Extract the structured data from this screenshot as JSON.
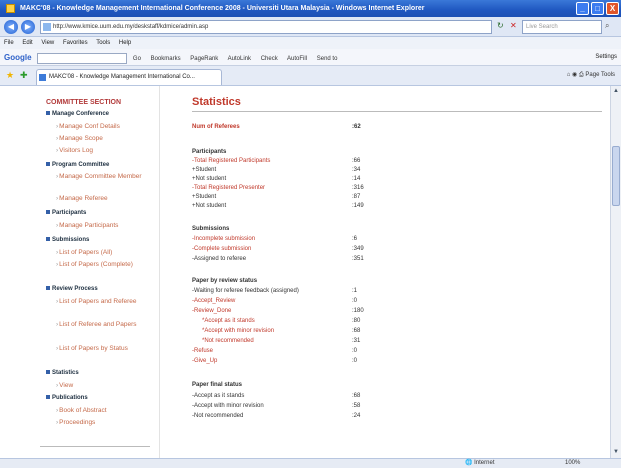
{
  "window": {
    "title": "MAKC'08 - Knowledge Management International Conference 2008 - Universiti Utara Malaysia - Windows Internet Explorer",
    "buttons": {
      "min": "_",
      "max": "□",
      "close": "X"
    }
  },
  "address": {
    "url": "http://www.kmice.uum.edu.my/deskstaff/kdmice/admin.asp",
    "search_placeholder": "Live Search"
  },
  "menu": [
    "File",
    "Edit",
    "View",
    "Favorites",
    "Tools",
    "Help"
  ],
  "google_toolbar": {
    "logo": "Google",
    "items": [
      "Go",
      "Bookmarks",
      "PageRank",
      "AutoLink",
      "Check",
      "AutoFill",
      "Send to"
    ],
    "settings": "Settings"
  },
  "tab": {
    "label": "MAKC'08 - Knowledge Management International Co...",
    "tools": [
      "Page",
      "Tools"
    ]
  },
  "sidebar": {
    "heading": "COMMITTEE SECTION",
    "groups": [
      {
        "label": "Manage Conference",
        "links": [
          "Manage Conf Details",
          "Manage Scope",
          "Visitors Log"
        ]
      },
      {
        "label": "Program Committee",
        "links": [
          "Manage Committee Member",
          "Manage Referee"
        ]
      },
      {
        "label": "Participants",
        "links": [
          "Manage Participants"
        ]
      },
      {
        "label": "Submissions",
        "links": [
          "List of Papers (All)",
          "List of Papers (Complete)"
        ]
      },
      {
        "label": "Review Process",
        "links": [
          "List of Papers and Referee",
          "List of Referee and Papers",
          "List of Papers by Status"
        ]
      },
      {
        "label": "Statistics",
        "links": [
          "View"
        ]
      },
      {
        "label": "Publications",
        "links": [
          "Book of Abstract",
          "Proceedings"
        ]
      }
    ]
  },
  "main": {
    "title": "Statistics",
    "num_referees": {
      "label": "Num of Referees",
      "value": ":62"
    },
    "participants": {
      "heading": "Participants",
      "rows": [
        {
          "label": "-Total Registered Participants",
          "value": ":66"
        },
        {
          "label": "  +Student",
          "value": ":34"
        },
        {
          "label": "  +Not student",
          "value": ":14"
        },
        {
          "label": "-Total Registered Presenter",
          "value": ":316"
        },
        {
          "label": "  +Student",
          "value": ":87"
        },
        {
          "label": "  +Not student",
          "value": ":149"
        }
      ]
    },
    "submissions": {
      "heading": "Submissions",
      "rows": [
        {
          "label": "-Incomplete submission",
          "value": ":6"
        },
        {
          "label": "-Complete submission",
          "value": ":349"
        },
        {
          "label": "-Assigned to referee",
          "value": ":351"
        }
      ]
    },
    "review_status": {
      "heading": "Paper by review status",
      "rows": [
        {
          "label": "-Waiting for referee feedback (assigned)",
          "value": ":1"
        },
        {
          "label": "-Accept_Review",
          "value": ":0"
        },
        {
          "label": "-Review_Done",
          "value": ":180"
        },
        {
          "label": "  *Accept as it stands",
          "value": ":80"
        },
        {
          "label": "  *Accept with minor revision",
          "value": ":68"
        },
        {
          "label": "  *Not recommended",
          "value": ":31"
        },
        {
          "label": "-Refuse",
          "value": ":0"
        },
        {
          "label": "-Give_Up",
          "value": ":0"
        }
      ]
    },
    "final_status": {
      "heading": "Paper final status",
      "rows": [
        {
          "label": "-Accept as it stands",
          "value": ":68"
        },
        {
          "label": "-Accept with minor revision",
          "value": ":58"
        },
        {
          "label": "-Not recommended",
          "value": ":24"
        }
      ]
    }
  },
  "status": {
    "zone": "Internet",
    "zoom": "100%"
  }
}
